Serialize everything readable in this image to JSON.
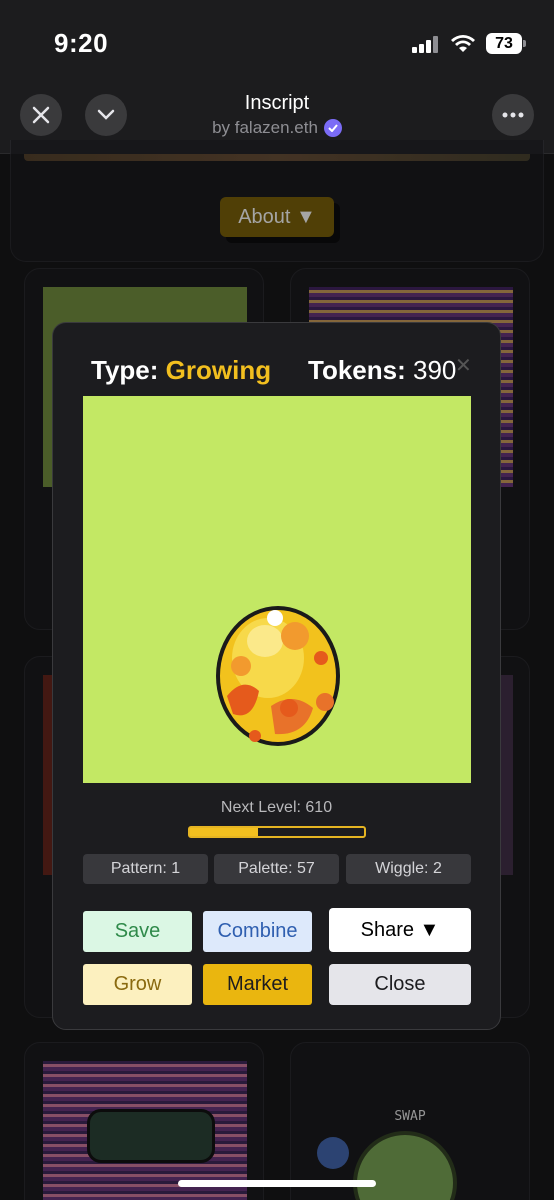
{
  "status": {
    "time": "9:20",
    "battery": "73"
  },
  "nav": {
    "title": "Inscript",
    "subtitle": "by falazen.eth"
  },
  "background": {
    "about_label": "About ▼",
    "swap_label": "SWAP"
  },
  "modal": {
    "type_label": "Type:",
    "type_value": "Growing",
    "tokens_label": "Tokens:",
    "tokens_value": "390",
    "next_level": "Next Level: 610",
    "progress": 0.39,
    "stats": [
      "Pattern: 1",
      "Palette: 57",
      "Wiggle: 2"
    ],
    "buttons": {
      "save": "Save",
      "combine": "Combine",
      "share": "Share ▼",
      "grow": "Grow",
      "market": "Market",
      "close": "Close"
    }
  },
  "colors": {
    "accent": "#f2bf1f",
    "canvas_bg": "#c3e864",
    "modal_bg": "#1c1c1f"
  }
}
